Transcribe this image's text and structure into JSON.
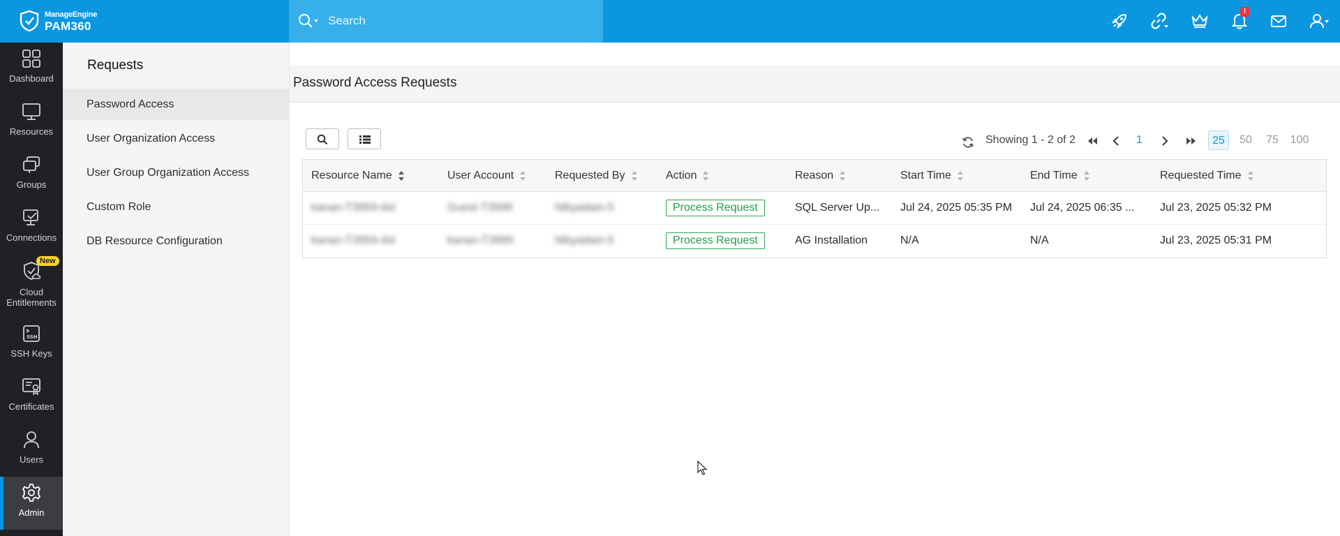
{
  "brand": {
    "company": "ManageEngine",
    "product": "PAM360"
  },
  "search": {
    "placeholder": "Search"
  },
  "top_icons": [
    "rocket-icon",
    "link-icon",
    "crown-icon",
    "bell-icon",
    "mail-icon",
    "user-icon"
  ],
  "notification_badge": "!",
  "colors": {
    "topbar": "#0a97e0",
    "accent": "#0a97e0",
    "success": "#21a047",
    "badge_new": "#ffd21f"
  },
  "leftnav": {
    "items": [
      {
        "label": "Dashboard",
        "icon": "dashboard-icon"
      },
      {
        "label": "Resources",
        "icon": "monitor-icon"
      },
      {
        "label": "Groups",
        "icon": "groups-icon"
      },
      {
        "label": "Connections",
        "icon": "connections-icon"
      },
      {
        "label": "Cloud Entitlements",
        "icon": "cloud-entitlements-icon",
        "badge": "New"
      },
      {
        "label": "SSH Keys",
        "icon": "ssh-keys-icon"
      },
      {
        "label": "Certificates",
        "icon": "certificates-icon"
      },
      {
        "label": "Users",
        "icon": "users-icon"
      },
      {
        "label": "Admin",
        "icon": "gear-icon",
        "active": true
      }
    ]
  },
  "subnav": {
    "title": "Requests",
    "items": [
      {
        "label": "Password Access",
        "active": true
      },
      {
        "label": "User Organization Access"
      },
      {
        "label": "User Group Organization Access"
      },
      {
        "label": "Custom Role"
      },
      {
        "label": "DB Resource Configuration"
      }
    ]
  },
  "page": {
    "title": "Password Access Requests"
  },
  "pagination": {
    "showing": "Showing 1 - 2 of 2",
    "current_page": "1",
    "page_sizes": [
      "25",
      "50",
      "75",
      "100"
    ],
    "selected_page_size": "25"
  },
  "table": {
    "columns": [
      "Resource Name",
      "User Account",
      "Requested By",
      "Action",
      "Reason",
      "Start Time",
      "End Time",
      "Requested Time"
    ],
    "rows": [
      {
        "resource_name": "kanan-T3959-dsl",
        "user_account": "Guest-T3999",
        "requested_by": "Nikyadain-5",
        "action": "Process Request",
        "reason": "SQL Server Up...",
        "start_time": "Jul 24, 2025 05:35 PM",
        "end_time": "Jul 24, 2025 06:35 ...",
        "requested_time": "Jul 23, 2025 05:32 PM"
      },
      {
        "resource_name": "kanan-T3959-dsl",
        "user_account": "kanan-T3999",
        "requested_by": "Nikyadain-5",
        "action": "Process Request",
        "reason": "AG Installation",
        "start_time": "N/A",
        "end_time": "N/A",
        "requested_time": "Jul 23, 2025 05:31 PM"
      }
    ]
  }
}
